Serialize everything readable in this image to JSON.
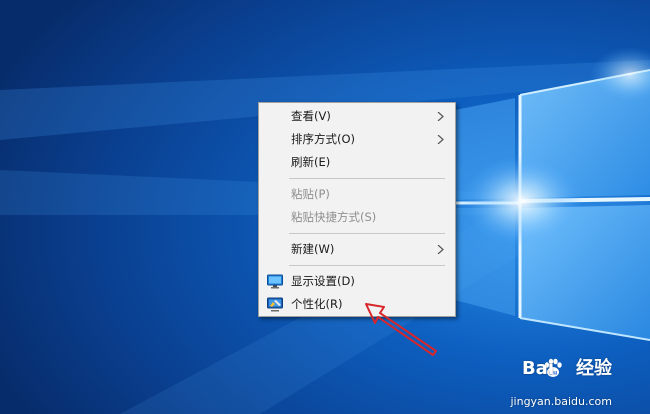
{
  "desktop": {
    "background_colors": [
      "#0b3a86",
      "#0d62c4",
      "#5fb6ff",
      "#e8f6ff"
    ]
  },
  "context_menu": {
    "items": [
      {
        "label": "查看(V)",
        "submenu": true,
        "enabled": true
      },
      {
        "label": "排序方式(O)",
        "submenu": true,
        "enabled": true
      },
      {
        "label": "刷新(E)",
        "submenu": false,
        "enabled": true
      },
      {
        "label": "粘贴(P)",
        "submenu": false,
        "enabled": false
      },
      {
        "label": "粘贴快捷方式(S)",
        "submenu": false,
        "enabled": false
      },
      {
        "label": "新建(W)",
        "submenu": true,
        "enabled": true
      },
      {
        "label": "显示设置(D)",
        "submenu": false,
        "enabled": true,
        "icon": "display-settings-icon"
      },
      {
        "label": "个性化(R)",
        "submenu": false,
        "enabled": true,
        "icon": "personalize-icon"
      }
    ]
  },
  "annotation": {
    "arrow_color": "#d9262a",
    "points_to": "个性化(R)"
  },
  "watermark": {
    "brand": "Bai",
    "brand_suffix": "经验",
    "site": "jingyan.baidu.com"
  }
}
